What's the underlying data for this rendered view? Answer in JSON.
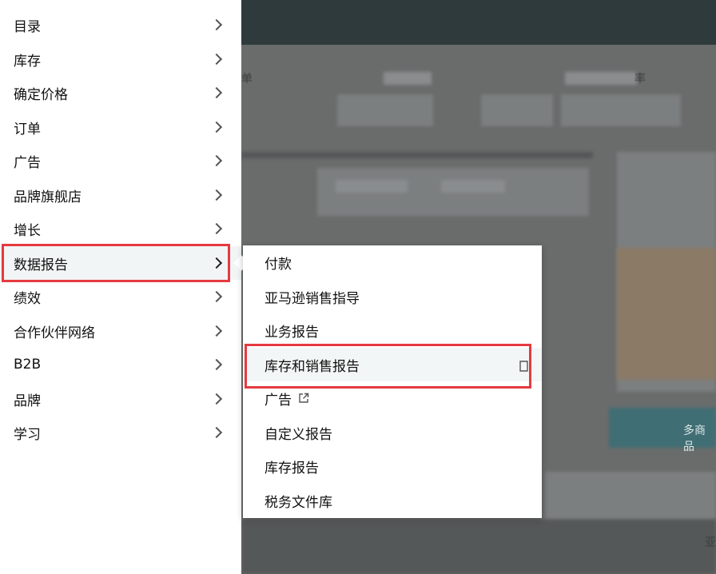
{
  "menu": {
    "items": [
      {
        "label": "目录"
      },
      {
        "label": "库存"
      },
      {
        "label": "确定价格"
      },
      {
        "label": "订单"
      },
      {
        "label": "广告"
      },
      {
        "label": "品牌旗舰店"
      },
      {
        "label": "增长"
      },
      {
        "label": "数据报告"
      },
      {
        "label": "绩效"
      },
      {
        "label": "合作伙伴网络"
      },
      {
        "label": "B2B"
      },
      {
        "label": "品牌"
      },
      {
        "label": "学习"
      }
    ],
    "active_item": "数据报告"
  },
  "submenu": {
    "items": [
      {
        "label": "付款"
      },
      {
        "label": "亚马逊销售指导"
      },
      {
        "label": "业务报告"
      },
      {
        "label": "库存和销售报告"
      },
      {
        "label": "广告",
        "icon": "external-link-icon"
      },
      {
        "label": "自定义报告"
      },
      {
        "label": "库存报告"
      },
      {
        "label": "税务文件库"
      }
    ],
    "active_item": "库存和销售报告"
  },
  "background": {
    "partial_text_1": "单",
    "partial_text_2": "率",
    "partial_text_3": "多商品",
    "partial_text_4": "亚"
  },
  "colors": {
    "highlight": "#e53a40",
    "menu_bg": "#ffffff",
    "overlay": "#5a5c5c"
  }
}
